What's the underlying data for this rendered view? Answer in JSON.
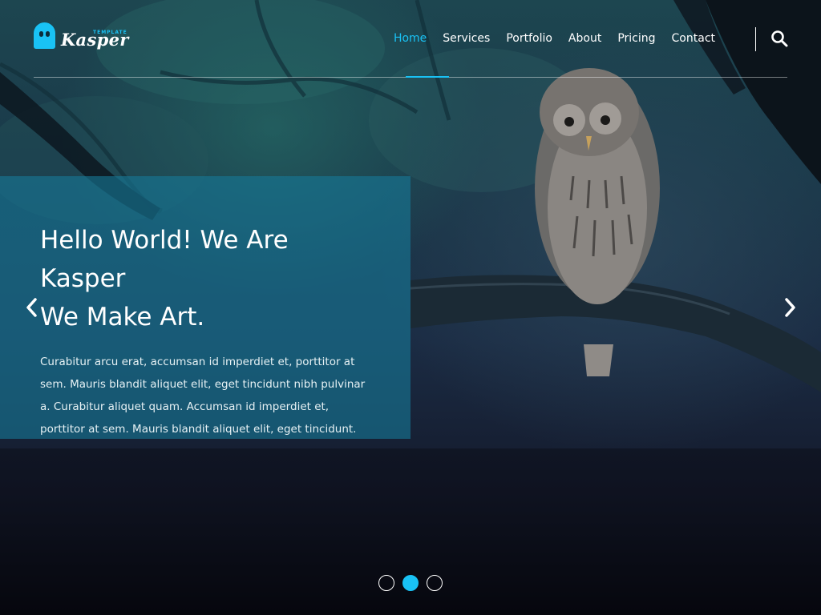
{
  "brand": {
    "name": "Kasper",
    "tagline": "TEMPLATE",
    "accent_color": "#19c2f5"
  },
  "nav": {
    "items": [
      {
        "label": "Home",
        "active": true
      },
      {
        "label": "Services",
        "active": false
      },
      {
        "label": "Portfolio",
        "active": false
      },
      {
        "label": "About",
        "active": false
      },
      {
        "label": "Pricing",
        "active": false
      },
      {
        "label": "Contact",
        "active": false
      }
    ],
    "search_icon": "search-icon"
  },
  "slider": {
    "heading_line1": "Hello World! We Are Kasper",
    "heading_line2": "We Make Art.",
    "body": "Curabitur arcu erat, accumsan id imperdiet et, porttitor at sem. Mauris blandit aliquet elit, eget tincidunt nibh pulvinar a. Curabitur aliquet quam. Accumsan id imperdiet et, porttitor at sem. Mauris blandit aliquet elit, eget tincidunt.",
    "prev_icon": "chevron-left-icon",
    "next_icon": "chevron-right-icon",
    "slide_count": 3,
    "active_slide": 2
  }
}
